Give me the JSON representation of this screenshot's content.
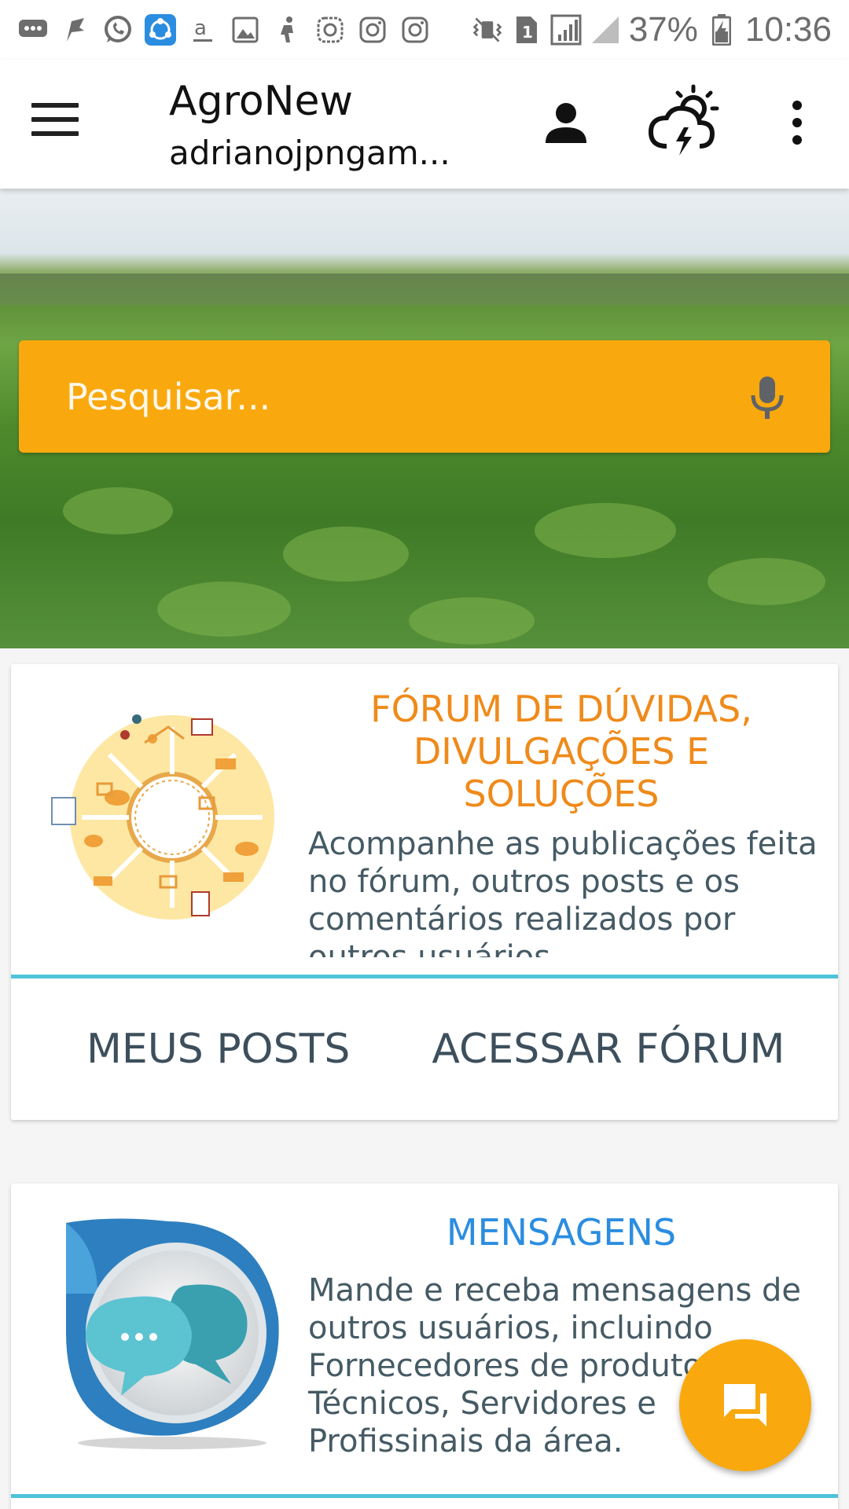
{
  "status_bar": {
    "battery": "37%",
    "time": "10:36",
    "sim_slot": "1"
  },
  "app_bar": {
    "title": "AgroNew",
    "subtitle": "adrianojpngam..."
  },
  "search": {
    "placeholder": "Pesquisar..."
  },
  "forum_card": {
    "title": "FÓRUM DE DÚVIDAS, DIVULGAÇÕES E SOLUÇÕES",
    "title_lines": [
      "FÓRUM DE DÚVIDAS,",
      "DIVULGAÇÕES E",
      "SOLUÇÕES"
    ],
    "description": "Acompanhe as publicações feita no fórum, outros posts e os comentários realizados por outros usuários",
    "my_posts_label": "MEUS POSTS",
    "access_forum_label": "ACESSAR FÓRUM",
    "title_color": "#ef8a1a"
  },
  "messages_card": {
    "title": "MENSAGENS",
    "description": "Mande e receba mensagens de outros usuários, incluindo Fornecedores de produtos, Técnicos, Servidores e Profissinais da área.",
    "title_color": "#2b8de0"
  },
  "colors": {
    "accent": "#f9a90e",
    "divider": "#4fc3d9"
  },
  "icons": {
    "menu": "hamburger-menu-icon",
    "profile": "person-icon",
    "weather": "weather-storm-icon",
    "more": "more-vert-icon",
    "mic": "microphone-icon",
    "fab": "chat-icon"
  }
}
